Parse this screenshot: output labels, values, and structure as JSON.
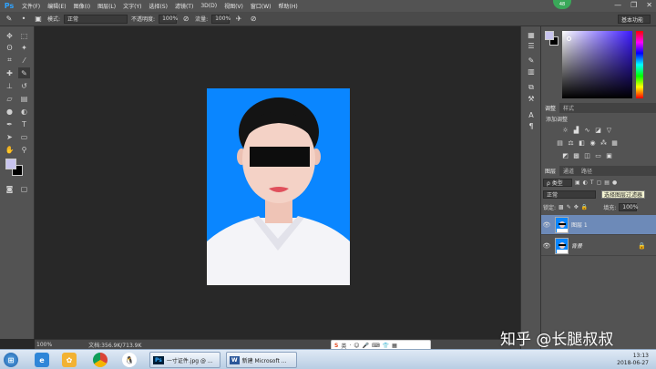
{
  "app": {
    "logo": "Ps",
    "fps_badge": "48"
  },
  "menu": [
    "文件(F)",
    "编辑(E)",
    "图像(I)",
    "图层(L)",
    "文字(Y)",
    "选择(S)",
    "滤镜(T)",
    "3D(D)",
    "视图(V)",
    "窗口(W)",
    "帮助(H)"
  ],
  "window_controls": {
    "minimize": "—",
    "restore": "❐",
    "close": "✕"
  },
  "options_bar": {
    "mode_label": "模式:",
    "mode_value": "正常",
    "opacity_label": "不透明度:",
    "opacity_value": "100%",
    "flow_label": "流量:",
    "flow_value": "100%",
    "workspace": "基本功能"
  },
  "colors": {
    "foreground": "#c8c4ee",
    "background": "#000000",
    "photo_bg": "#0a86ff"
  },
  "status_bar": {
    "zoom": "100%",
    "doc": "文档:356.9K/713.9K"
  },
  "panels": {
    "top_tabs": [
      "调整",
      "样式"
    ],
    "adjust_title": "添加调整",
    "layer_tabs": [
      "图层",
      "通道",
      "路径"
    ],
    "kind_filter": "ρ 类型",
    "blend_mode": "正常",
    "filter_tooltip": "选择图层过滤器",
    "lock_label": "锁定:",
    "fill_label": "填充:",
    "fill_value": "100%",
    "layers": [
      {
        "name": "图层 1",
        "selected": true
      },
      {
        "name": "背景",
        "selected": false,
        "italic": true
      }
    ]
  },
  "ime": {
    "label": "英"
  },
  "taskbar": {
    "tasks": [
      {
        "label": "一寸证件.jpg @ ..."
      },
      {
        "label": "新建 Microsoft ..."
      }
    ],
    "time": "13:13",
    "date": "2018-06-27"
  },
  "watermark": "知乎 @长腿叔叔"
}
